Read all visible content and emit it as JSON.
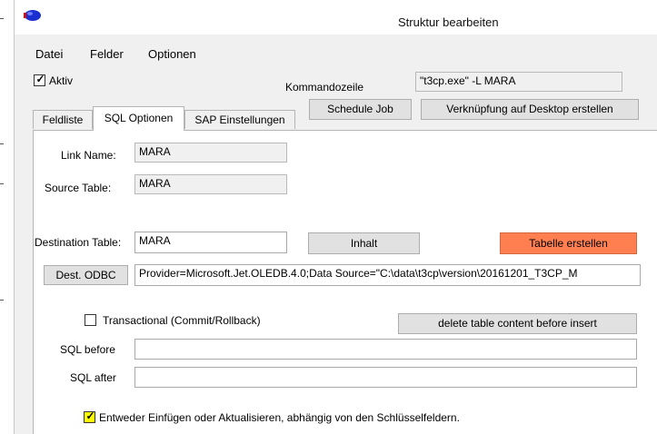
{
  "window": {
    "title": "Struktur bearbeiten"
  },
  "menu": {
    "items": [
      "Datei",
      "Felder",
      "Optionen"
    ]
  },
  "aktiv": {
    "label": "Aktiv",
    "checked": true
  },
  "command_line": {
    "label": "Kommandozeile",
    "value": "\"t3cp.exe\" -L MARA"
  },
  "buttons": {
    "schedule_job": "Schedule Job",
    "desktop_shortcut": "Verknüpfung auf Desktop erstellen",
    "inhalt": "Inhalt",
    "tabelle_erstellen": "Tabelle erstellen",
    "dest_odbc": "Dest. ODBC",
    "delete_content": "delete table content before insert"
  },
  "tabs": [
    {
      "label": "Feldliste",
      "active": false
    },
    {
      "label": "SQL Optionen",
      "active": true
    },
    {
      "label": "SAP Einstellungen",
      "active": false
    }
  ],
  "form": {
    "link_name_label": "Link Name:",
    "link_name_value": "MARA",
    "source_table_label": "Source Table:",
    "source_table_value": "MARA",
    "destination_table_label": "Destination Table:",
    "destination_table_value": "MARA",
    "connection_string": "Provider=Microsoft.Jet.OLEDB.4.0;Data Source=\"C:\\data\\t3cp\\version\\20161201_T3CP_M",
    "transactional_label": "Transactional (Commit/Rollback)",
    "transactional_checked": false,
    "sql_before_label": "SQL before",
    "sql_before_value": "",
    "sql_after_label": "SQL after",
    "sql_after_value": "",
    "upsert_label": "Entweder Einfügen oder Aktualisieren, abhängig von den Schlüsselfeldern.",
    "upsert_checked": true
  },
  "colors": {
    "tabelle_erstellen_bg": "#ff7f50",
    "upsert_checkbox_bg": "#ffff00"
  }
}
